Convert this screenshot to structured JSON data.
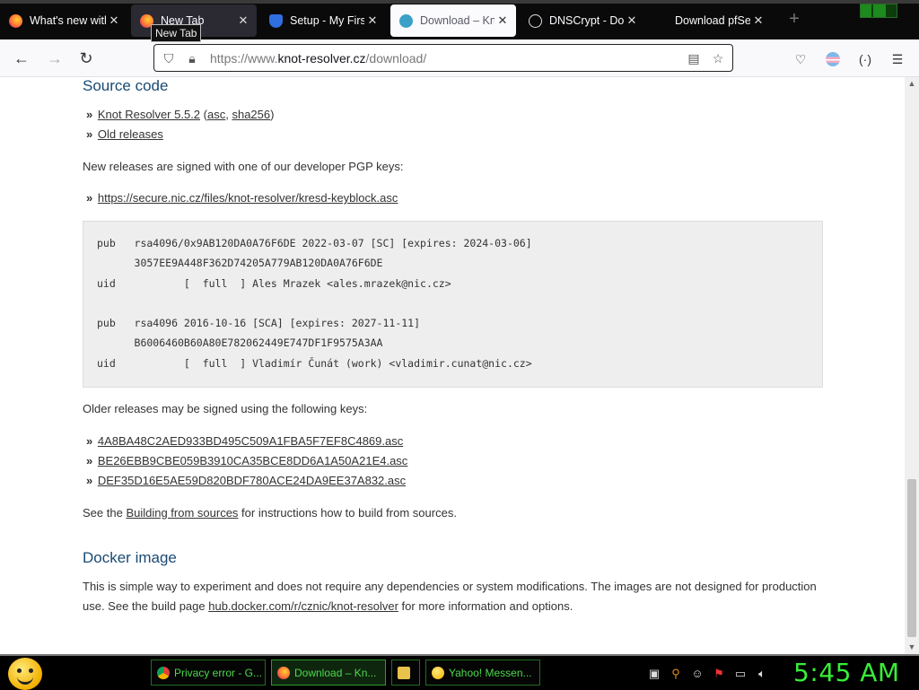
{
  "browser": {
    "tabs": [
      {
        "title": "What's new with",
        "icon": "firefox-icon",
        "active": false
      },
      {
        "title": "New Tab",
        "icon": "firefox-icon",
        "active": false,
        "hover": true
      },
      {
        "title": "Setup - My First",
        "icon": "shield-icon",
        "active": false
      },
      {
        "title": "Download – Kn",
        "icon": "knot-icon",
        "active": true
      },
      {
        "title": "DNSCrypt - Dow",
        "icon": "globe-icon",
        "active": false
      },
      {
        "title": "Download pfSen",
        "icon": "",
        "active": false
      }
    ],
    "tooltip": "New Tab",
    "new_tab_label": "+",
    "url_prefix": "https://www.",
    "url_domain": "knot-resolver.cz",
    "url_path": "/download/"
  },
  "page": {
    "source_heading": "Source code",
    "source_links": {
      "release_text": "Knot Resolver 5.5.2",
      "asc": "asc",
      "sha256": "sha256",
      "old_releases": "Old releases"
    },
    "signed_text": "New releases are signed with one of our developer PGP keys:",
    "keyblock_link": "https://secure.nic.cz/files/knot-resolver/kresd-keyblock.asc",
    "keyblock": {
      "line1": "pub   rsa4096/0x9AB120DA0A76F6DE 2022-03-07 [SC] [expires: 2024-03-06]",
      "line2": "      3057EE9A448F362D74205A779AB120DA0A76F6DE",
      "line3": "uid           [  full  ] Ales Mrazek <ales.mrazek@nic.cz>",
      "line4": "pub   rsa4096 2016-10-16 [SCA] [expires: 2027-11-11]",
      "line5": "      B6006460B60A80E782062449E747DF1F9575A3AA",
      "line6": "uid           [  full  ] Vladimír Čunát (work) <vladimir.cunat@nic.cz>"
    },
    "older_text": "Older releases may be signed using the following keys:",
    "older_keys": [
      "4A8BA48C2AED933BD495C509A1FBA5F7EF8C4869.asc",
      "BE26EBB9CBE059B3910CA35BCE8DD6A1A50A21E4.asc",
      "DEF35D16E5AE59D820BDF780ACE24DA9EE37A832.asc"
    ],
    "build_before": "See the ",
    "build_link": "Building from sources",
    "build_after": " for instructions how to build from sources.",
    "docker_heading": "Docker image",
    "docker_text1": "This is simple way to experiment and does not require any dependencies or system modifications. The images are not designed for production use. See the build page ",
    "docker_link": "hub.docker.com/r/cznic/knot-resolver",
    "docker_text2": " for more information and options."
  },
  "taskbar": {
    "buttons": [
      {
        "label": "Privacy error - G...",
        "icon": "chrome-icon",
        "active": false
      },
      {
        "label": "Download – Kn...",
        "icon": "firefox-icon",
        "active": true
      },
      {
        "label": "",
        "icon": "folder-icon",
        "active": false
      },
      {
        "label": "Yahoo! Messen...",
        "icon": "yahoo-messenger-icon",
        "active": false
      }
    ],
    "clock": "5:45 AM"
  },
  "colors": {
    "heading": "#1a4a73",
    "taskbar_text": "#4dd84d",
    "clock": "#38ee38",
    "active_tab_bg": "#fbfbfe"
  }
}
